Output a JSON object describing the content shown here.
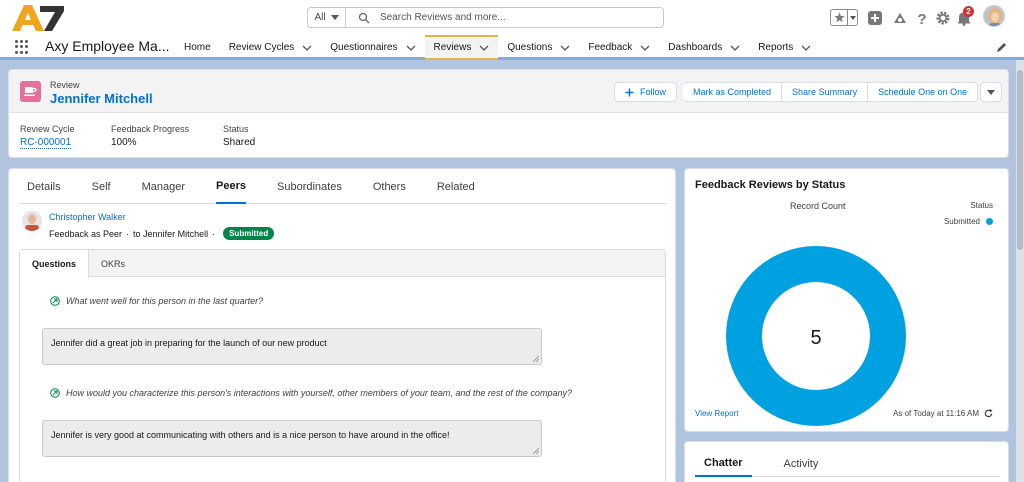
{
  "header": {
    "search": {
      "scope": "All",
      "placeholder": "Search Reviews and more..."
    },
    "notifications_count": "2"
  },
  "nav": {
    "app_name": "Axy Employee Ma...",
    "items": [
      {
        "label": "Home",
        "dropdown": false,
        "active": false
      },
      {
        "label": "Review Cycles",
        "dropdown": true,
        "active": false
      },
      {
        "label": "Questionnaires",
        "dropdown": true,
        "active": false
      },
      {
        "label": "Reviews",
        "dropdown": true,
        "active": true
      },
      {
        "label": "Questions",
        "dropdown": true,
        "active": false
      },
      {
        "label": "Feedback",
        "dropdown": true,
        "active": false
      },
      {
        "label": "Dashboards",
        "dropdown": true,
        "active": false
      },
      {
        "label": "Reports",
        "dropdown": true,
        "active": false
      }
    ]
  },
  "record": {
    "object_label": "Review",
    "name": "Jennifer Mitchell",
    "actions": {
      "follow": "Follow",
      "mark_completed": "Mark as Completed",
      "share_summary": "Share Summary",
      "schedule": "Schedule One on One"
    },
    "fields": {
      "review_cycle_label": "Review Cycle",
      "review_cycle_value": "RC-000001",
      "progress_label": "Feedback Progress",
      "progress_value": "100%",
      "status_label": "Status",
      "status_value": "Shared"
    }
  },
  "main": {
    "tabs": [
      "Details",
      "Self",
      "Manager",
      "Peers",
      "Subordinates",
      "Others",
      "Related"
    ],
    "active_tab": "Peers",
    "feedback": {
      "reviewer": "Christopher Walker",
      "type": "Feedback as Peer",
      "separator": "·",
      "target": "to Jennifer Mitchell",
      "badge": "Submitted"
    },
    "inner_tabs": [
      "Questions",
      "OKRs"
    ],
    "questions": [
      {
        "question": "What went well for this person in the last quarter?",
        "answer": "Jennifer did a great job in preparing for the launch of our new product"
      },
      {
        "question": "How would you characterize this person's interactions with yourself, other members of your team, and the rest of the company?",
        "answer": "Jennifer is very good at communicating with others and is a nice person to have around in the office!"
      }
    ]
  },
  "chart": {
    "title": "Feedback Reviews by Status",
    "view_report": "View Report",
    "as_of": "As of Today at 11:16 AM",
    "color": "#00a1e0"
  },
  "chart_data": {
    "type": "pie",
    "ylabel": "Record Count",
    "legend_title": "Status",
    "legend_position": "right",
    "categories": [
      "Submitted"
    ],
    "values": [
      5
    ],
    "total": "5"
  },
  "chatter": {
    "tabs": [
      "Chatter",
      "Activity"
    ]
  }
}
